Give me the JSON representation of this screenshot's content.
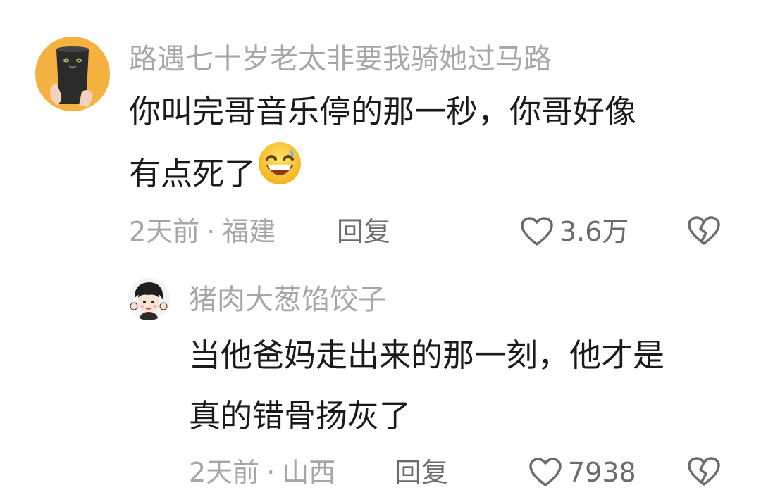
{
  "comment": {
    "username": "路遇七十岁老太非要我骑她过马路",
    "lines": [
      "你叫完哥音乐停的那一秒，你哥好像",
      "有点死了"
    ],
    "emoji": "grinning-sweat-emoji",
    "time": "2天前",
    "separator": "·",
    "location": "福建",
    "reply_label": "回复",
    "likes": "3.6万",
    "like_icon": "heart-icon",
    "dislike_icon": "broken-heart-icon"
  },
  "reply": {
    "username": "猪肉大葱馅饺子",
    "lines": [
      "当他爸妈走出来的那一刻，他才是",
      "真的错骨扬灰了"
    ],
    "time": "2天前",
    "separator": "·",
    "location": "山西",
    "reply_label": "回复",
    "likes": "7938",
    "like_icon": "heart-icon",
    "dislike_icon": "broken-heart-icon"
  },
  "colors": {
    "username": "#a6a6a6",
    "content": "#1a1a1a",
    "meta": "#a6a6a6",
    "action": "#6b6b6b",
    "avatar_bg": "#f5b240"
  }
}
